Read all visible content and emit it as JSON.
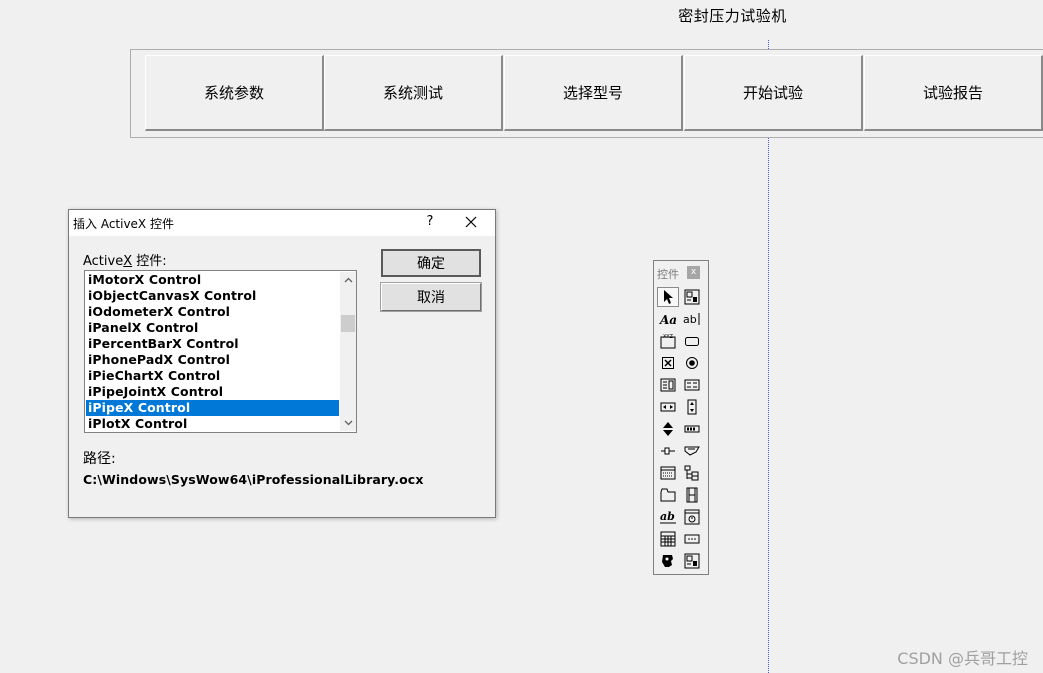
{
  "app": {
    "title": "密封压力试验机"
  },
  "toolbar": {
    "buttons": [
      {
        "label": "系统参数"
      },
      {
        "label": "系统测试"
      },
      {
        "label": "选择型号"
      },
      {
        "label": "开始试验"
      },
      {
        "label": "试验报告"
      }
    ]
  },
  "dialog": {
    "title": "插入 ActiveX 控件",
    "help_label": "?",
    "list_label_prefix": "Active",
    "list_label_underlined": "X",
    "list_label_suffix": " 控件:",
    "items": [
      {
        "label": "iMotorX Control"
      },
      {
        "label": "iObjectCanvasX Control"
      },
      {
        "label": "iOdometerX Control"
      },
      {
        "label": "iPanelX Control"
      },
      {
        "label": "iPercentBarX Control"
      },
      {
        "label": "iPhonePadX Control"
      },
      {
        "label": "iPieChartX Control"
      },
      {
        "label": "iPipeJointX Control"
      },
      {
        "label": "iPipeX Control",
        "selected": true
      },
      {
        "label": "iPlotX Control"
      }
    ],
    "ok_label": "确定",
    "cancel_label": "取消",
    "path_label": "路径:",
    "path_value": "C:\\Windows\\SysWow64\\iProfessionalLibrary.ocx",
    "selection_color": "#0078d7"
  },
  "palette": {
    "title": "控件",
    "close_label": "x",
    "tools": [
      "select-pointer-icon",
      "activex-control-icon",
      "label-icon",
      "edit-box-icon",
      "group-box-icon",
      "button-icon",
      "check-box-icon",
      "radio-button-icon",
      "combo-box-icon",
      "list-box-icon",
      "horizontal-scrollbar-icon",
      "vertical-scrollbar-icon",
      "spin-icon",
      "progress-icon",
      "slider-icon",
      "hotkey-icon",
      "list-control-icon",
      "tree-control-icon",
      "tab-control-icon",
      "animation-icon",
      "rich-edit-icon",
      "date-time-picker-icon",
      "month-calendar-icon",
      "ip-address-icon",
      "custom-control-icon",
      "extended-combo-icon"
    ]
  },
  "watermark": "CSDN @兵哥工控"
}
